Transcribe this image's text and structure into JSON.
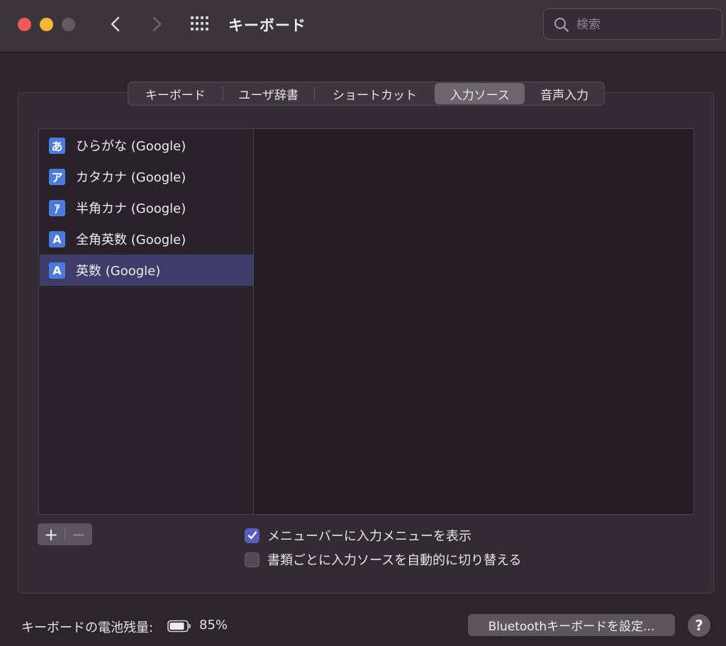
{
  "window": {
    "title": "キーボード",
    "search_placeholder": "検索"
  },
  "tabs": [
    {
      "label": "キーボード",
      "active": false
    },
    {
      "label": "ユーザ辞書",
      "active": false
    },
    {
      "label": "ショートカット",
      "active": false
    },
    {
      "label": "入力ソース",
      "active": true
    },
    {
      "label": "音声入力",
      "active": false
    }
  ],
  "input_sources": [
    {
      "badge": "あ",
      "label": "ひらがな (Google)",
      "selected": false
    },
    {
      "badge": "ア",
      "label": "カタカナ (Google)",
      "selected": false
    },
    {
      "badge": "ｱ",
      "label": "半角カナ (Google)",
      "selected": false
    },
    {
      "badge": "A",
      "label": "全角英数 (Google)",
      "selected": false
    },
    {
      "badge": "A",
      "label": "英数 (Google)",
      "selected": true
    }
  ],
  "list_controls": {
    "add": "+",
    "remove": "−"
  },
  "options": [
    {
      "label": "メニューバーに入力メニューを表示",
      "checked": true
    },
    {
      "label": "書類ごとに入力ソースを自動的に切り替える",
      "checked": false
    }
  ],
  "footer": {
    "battery_label": "キーボードの電池残量:",
    "battery_percent": "85%",
    "bluetooth_button": "Bluetoothキーボードを設定...",
    "help": "?"
  },
  "colors": {
    "accent": "#5b5cc0",
    "selection": "#3e3d6a",
    "badge": "#4c7bdc"
  },
  "icons": [
    "back-icon",
    "forward-icon",
    "grid-icon",
    "search-icon",
    "battery-icon",
    "checkmark-icon"
  ]
}
